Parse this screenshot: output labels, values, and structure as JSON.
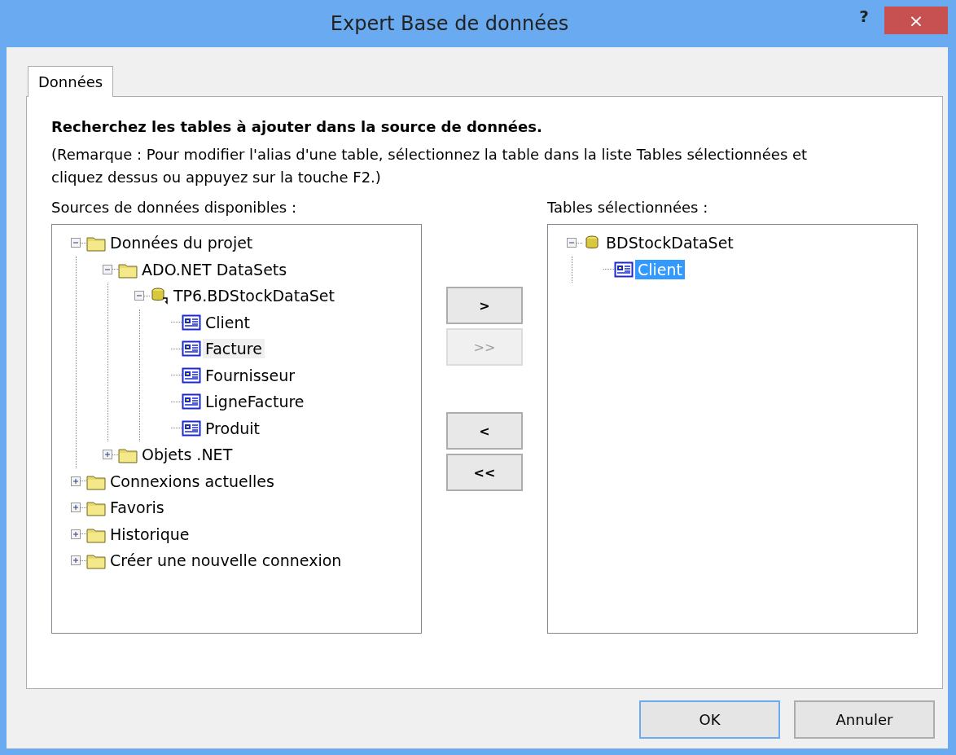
{
  "window": {
    "title": "Expert Base de données",
    "help": "?",
    "close": "×"
  },
  "tabs": [
    {
      "label": "Données",
      "selected": true
    }
  ],
  "heading": "Recherchez les tables à ajouter dans la source de données.",
  "note": "(Remarque : Pour modifier l'alias d'une table, sélectionnez la table dans la liste Tables sélectionnées et cliquez dessus ou appuyez sur la touche F2.)",
  "available": {
    "label": "Sources de données disponibles :",
    "focused": false,
    "items": [
      {
        "kind": "folder",
        "label": "Données du projet",
        "expanded": true,
        "selected": false,
        "children": [
          {
            "kind": "folder",
            "label": "ADO.NET DataSets",
            "expanded": true,
            "selected": false,
            "children": [
              {
                "kind": "dataset",
                "label": "TP6.BDStockDataSet",
                "expanded": true,
                "selected": false,
                "children": [
                  {
                    "kind": "table",
                    "label": "Client",
                    "selected": false
                  },
                  {
                    "kind": "table",
                    "label": "Facture",
                    "selected": true
                  },
                  {
                    "kind": "table",
                    "label": "Fournisseur",
                    "selected": false
                  },
                  {
                    "kind": "table",
                    "label": "LigneFacture",
                    "selected": false
                  },
                  {
                    "kind": "table",
                    "label": "Produit",
                    "selected": false
                  }
                ]
              }
            ]
          },
          {
            "kind": "folder",
            "label": "Objets .NET",
            "expanded": false,
            "selected": false
          }
        ]
      },
      {
        "kind": "folder",
        "label": "Connexions actuelles",
        "expanded": false,
        "selected": false
      },
      {
        "kind": "folder",
        "label": "Favoris",
        "expanded": false,
        "selected": false
      },
      {
        "kind": "folder",
        "label": "Historique",
        "expanded": false,
        "selected": false
      },
      {
        "kind": "folder",
        "label": "Créer une nouvelle connexion",
        "expanded": false,
        "selected": false
      }
    ]
  },
  "move_buttons": [
    {
      "label": ">",
      "disabled": false
    },
    {
      "label": ">>",
      "disabled": true
    },
    {
      "label": "<",
      "disabled": false
    },
    {
      "label": "<<",
      "disabled": false
    }
  ],
  "chosen": {
    "label": "Tables sélectionnées :",
    "focused": true,
    "items": [
      {
        "kind": "dataset_plain",
        "label": "BDStockDataSet",
        "expanded": true,
        "selected": false,
        "children": [
          {
            "kind": "table",
            "label": "Client",
            "selected": true
          }
        ]
      }
    ]
  },
  "buttons": [
    {
      "label": "OK",
      "default": true
    },
    {
      "label": "Annuler",
      "default": false
    }
  ]
}
